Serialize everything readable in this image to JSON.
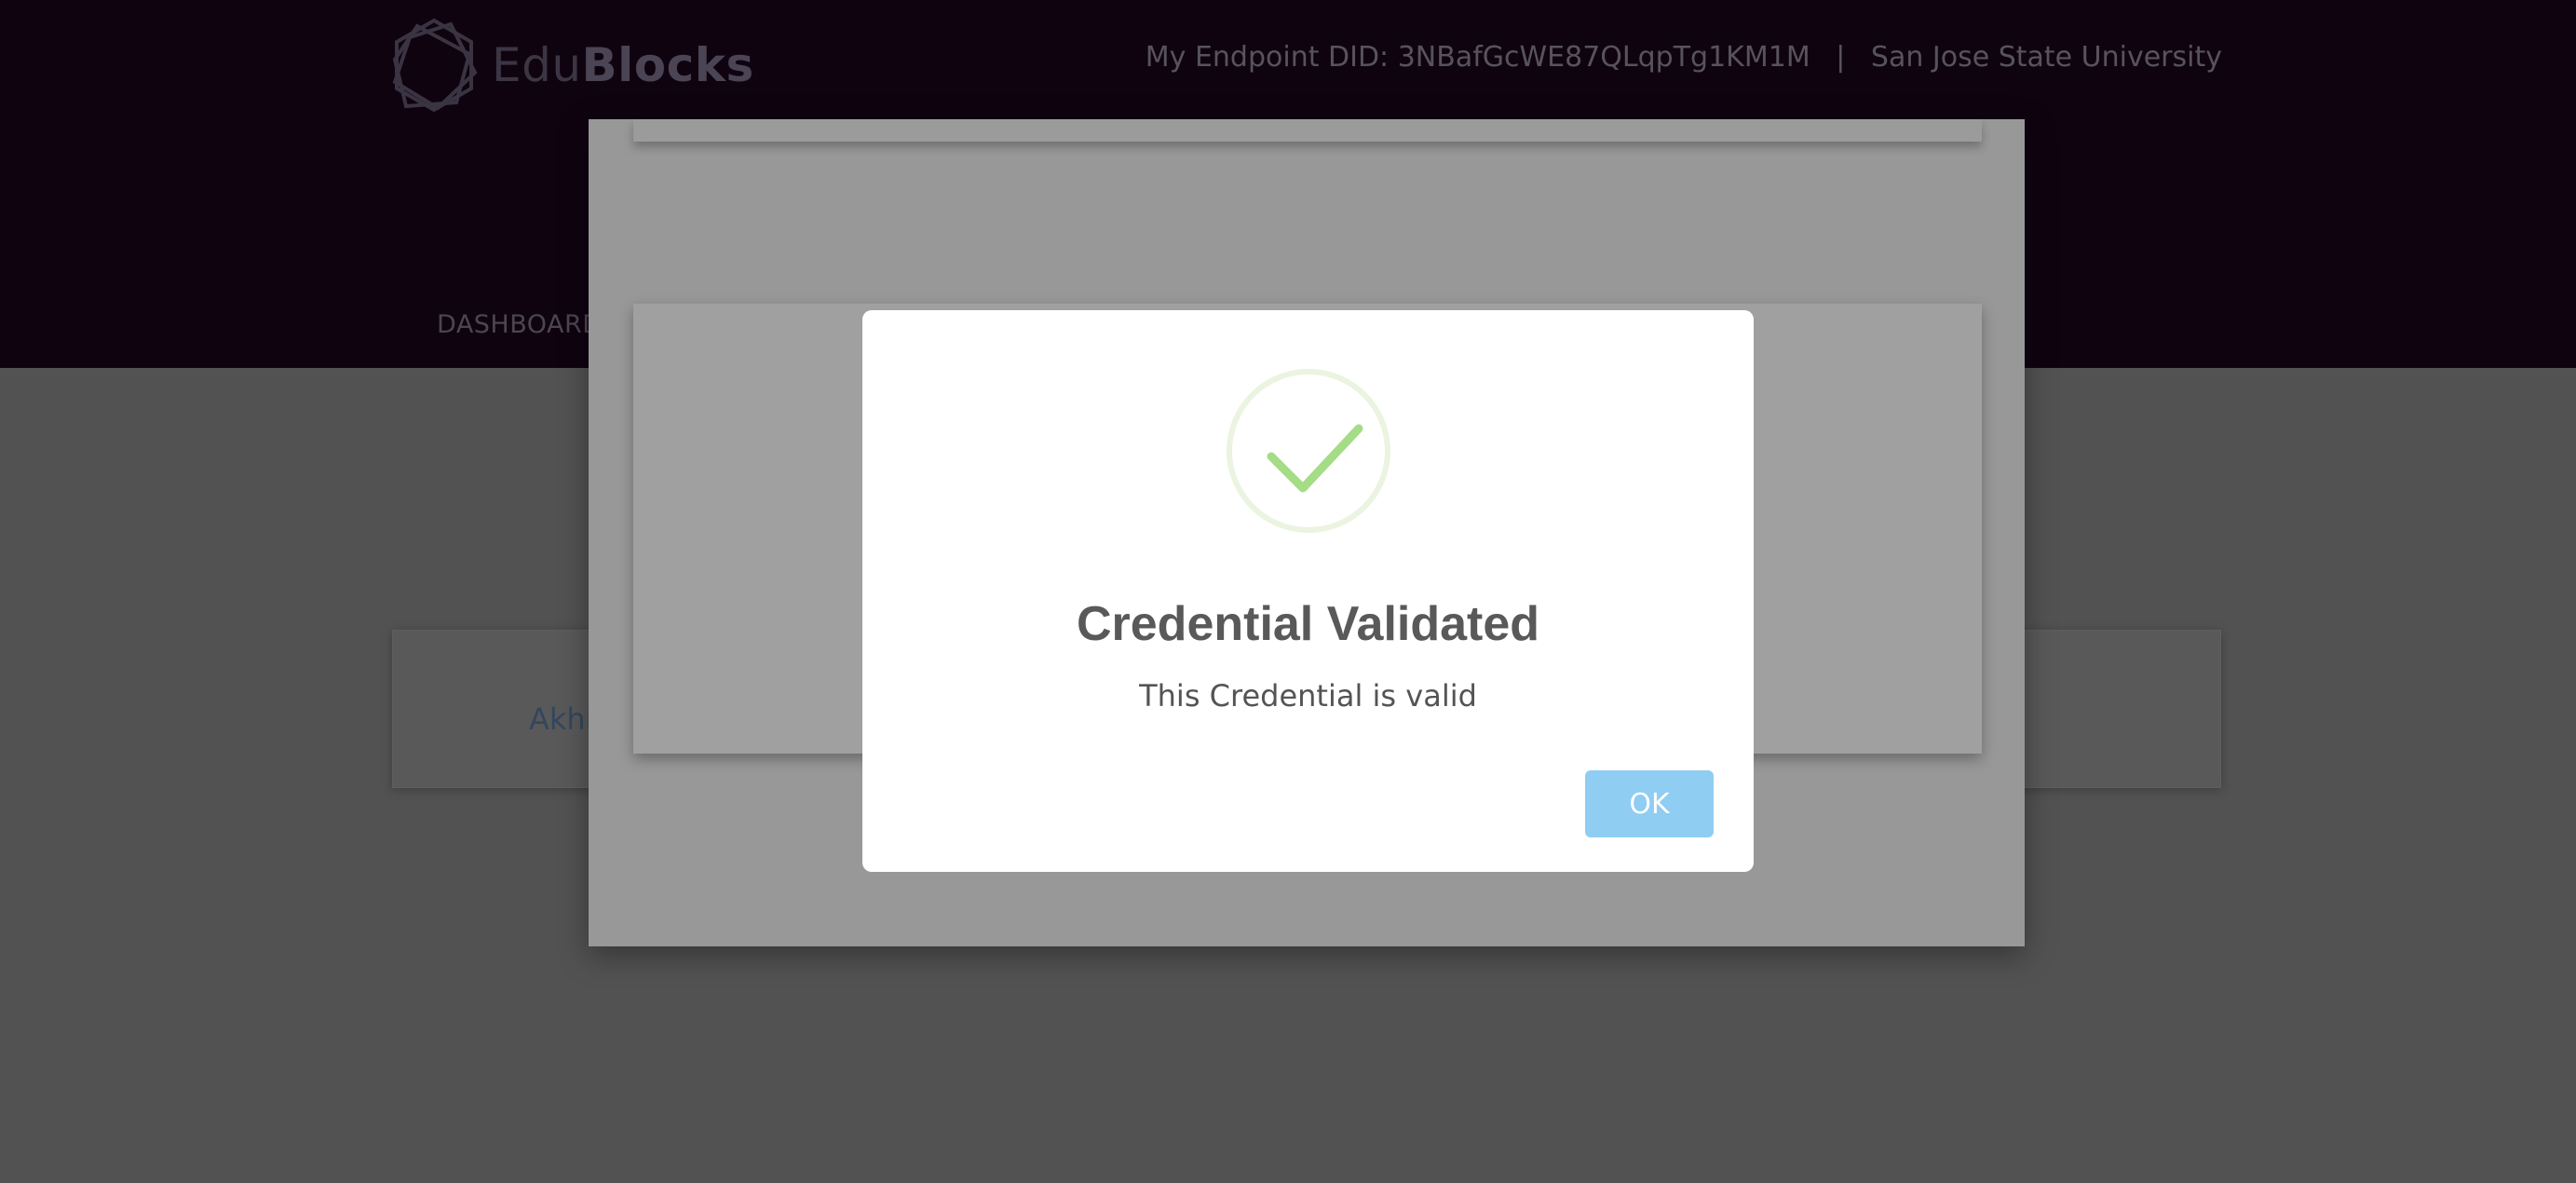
{
  "header": {
    "brand_light": "Edu",
    "brand_bold": "Blocks",
    "endpoint_label": "My Endpoint DID:",
    "endpoint_did": "3NBafGcWE87QLqpTg1KM1M",
    "separator": "|",
    "university": "San Jose State University"
  },
  "nav": {
    "dashboard_label": "DASHBOARD"
  },
  "content": {
    "student_name_partial": "Akhi"
  },
  "alert": {
    "icon": "success-check-icon",
    "title": "Credential Validated",
    "text": "This Credential is valid",
    "ok_label": "OK"
  },
  "colors": {
    "header_bg": "#0f0310",
    "success": "#a5dc86",
    "ok_button": "#8fcdf2"
  }
}
